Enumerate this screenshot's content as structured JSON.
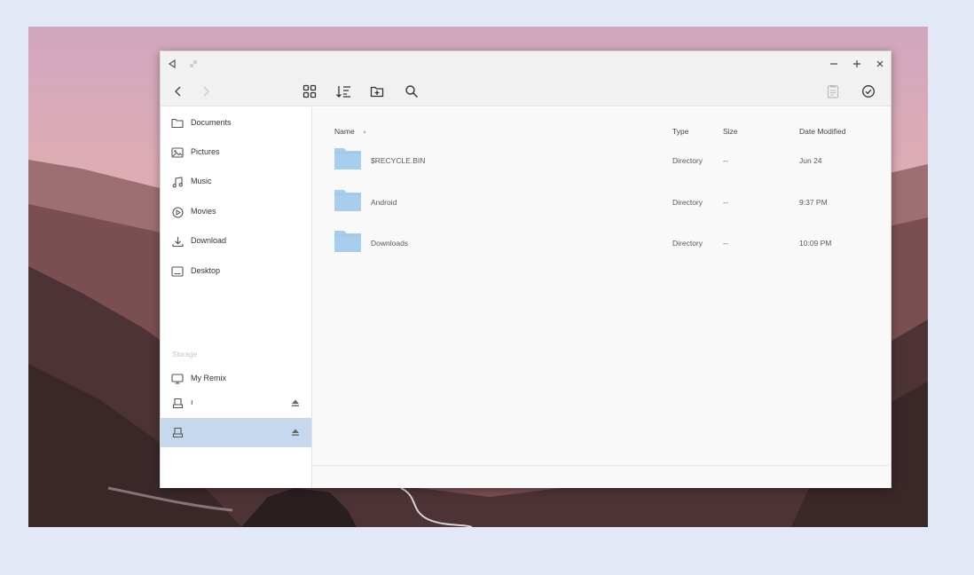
{
  "titlebar": {
    "icons": [
      "back-triangle-icon",
      "restore-icon",
      "minimize-icon",
      "maximize-icon",
      "close-icon"
    ]
  },
  "toolbar": {
    "icons": [
      "chevron-left-icon",
      "chevron-right-icon",
      "grid-view-icon",
      "sort-icon",
      "new-folder-icon",
      "search-icon",
      "clipboard-icon",
      "select-check-icon"
    ]
  },
  "sidebar": {
    "items": [
      {
        "label": "Documents",
        "icon": "folder-icon"
      },
      {
        "label": "Pictures",
        "icon": "image-icon"
      },
      {
        "label": "Music",
        "icon": "music-note-icon"
      },
      {
        "label": "Movies",
        "icon": "play-circle-icon"
      },
      {
        "label": "Download",
        "icon": "download-icon"
      },
      {
        "label": "Desktop",
        "icon": "monitor-window-icon"
      }
    ],
    "storage_label": "Storage",
    "storage": [
      {
        "label": "My Remix",
        "icon": "computer-icon",
        "eject": false
      },
      {
        "label": "ı",
        "icon": "drive-icon",
        "eject": true
      },
      {
        "label": "",
        "icon": "drive-icon",
        "eject": true,
        "selected": true
      }
    ]
  },
  "columns": {
    "name": "Name",
    "type": "Type",
    "size": "Size",
    "date": "Date Modified"
  },
  "files": [
    {
      "name": "$RECYCLE.BIN",
      "type": "Directory",
      "size": "--",
      "date": "Jun 24"
    },
    {
      "name": "Android",
      "type": "Directory",
      "size": "--",
      "date": "9:37 PM"
    },
    {
      "name": "Downloads",
      "type": "Directory",
      "size": "--",
      "date": "10:09 PM"
    }
  ],
  "colors": {
    "folder": "#a9cdec",
    "selected": "#c6d8ee",
    "background": "#e3e8f6"
  }
}
